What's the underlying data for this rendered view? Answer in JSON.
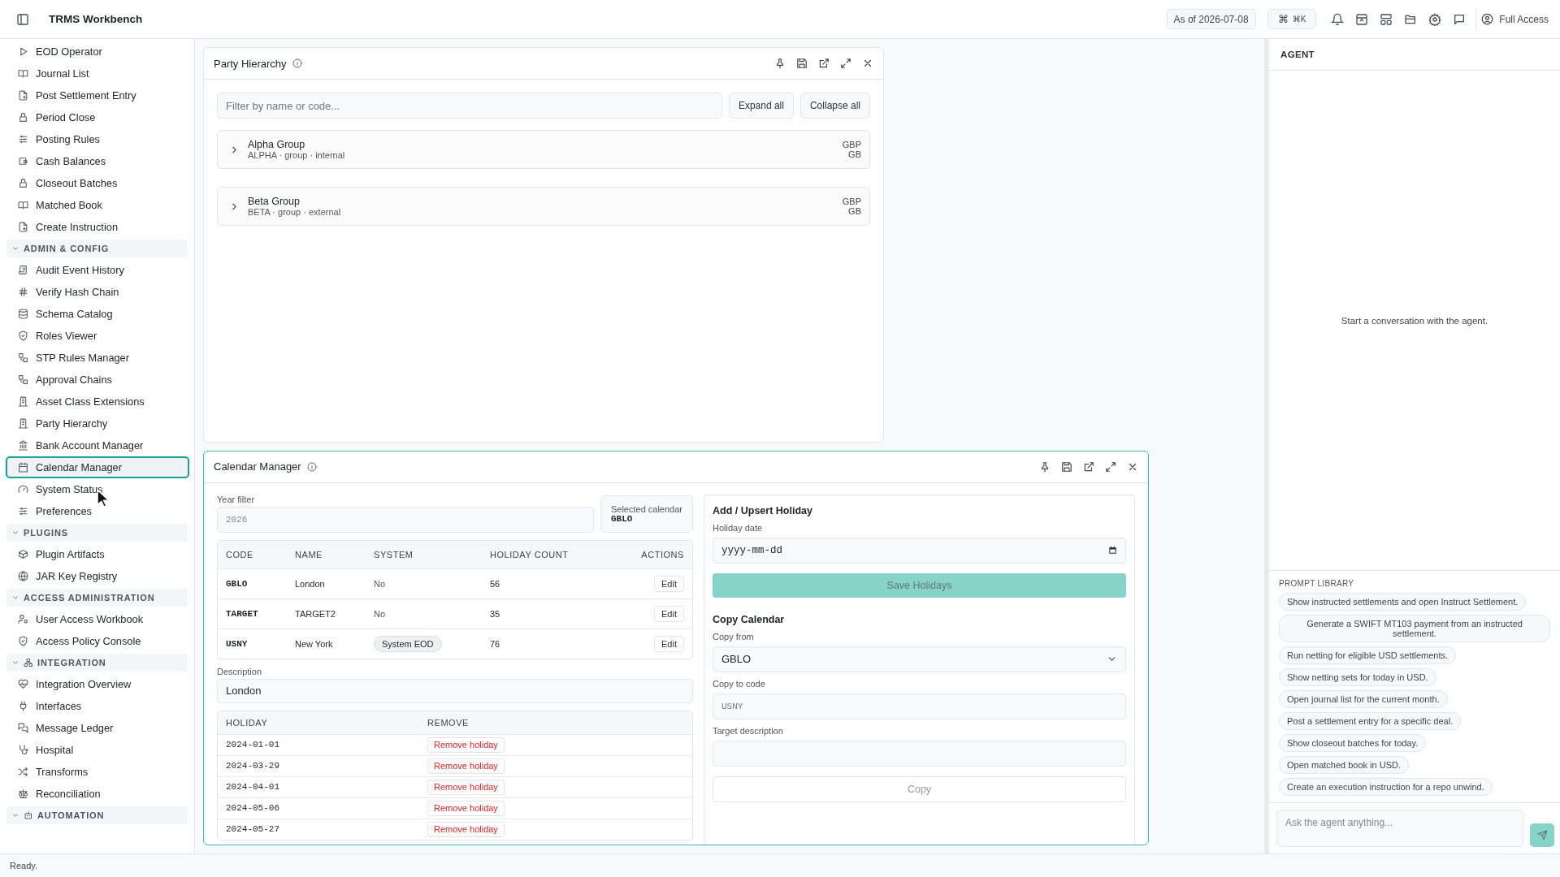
{
  "top_bar": {
    "title": "TRMS Workbench",
    "as_of": "As of 2026-07-08",
    "shortcut": {
      "symbol": "⌘",
      "keys": "⌘K"
    },
    "user": "Full Access"
  },
  "sidebar": {
    "items": [
      {
        "label": "EOD Operator",
        "selected": false
      },
      {
        "label": "Journal List",
        "selected": false
      },
      {
        "label": "Post Settlement Entry",
        "selected": false
      },
      {
        "label": "Period Close",
        "selected": false
      },
      {
        "label": "Posting Rules",
        "selected": false
      },
      {
        "label": "Cash Balances",
        "selected": false
      },
      {
        "label": "Closeout Batches",
        "selected": false
      },
      {
        "label": "Matched Book",
        "selected": false
      },
      {
        "label": "Create Instruction",
        "selected": false
      }
    ],
    "sections": [
      {
        "label": "ADMIN & CONFIG",
        "expanded": true,
        "items": [
          {
            "label": "Audit Event History",
            "selected": false
          },
          {
            "label": "Verify Hash Chain",
            "selected": false
          },
          {
            "label": "Schema Catalog",
            "selected": false
          },
          {
            "label": "Roles Viewer",
            "selected": false
          },
          {
            "label": "STP Rules Manager",
            "selected": false
          },
          {
            "label": "Approval Chains",
            "selected": false
          },
          {
            "label": "Asset Class Extensions",
            "selected": false
          },
          {
            "label": "Party Hierarchy",
            "selected": false
          },
          {
            "label": "Bank Account Manager",
            "selected": false
          },
          {
            "label": "Calendar Manager",
            "selected": true
          },
          {
            "label": "System Status",
            "selected": false
          },
          {
            "label": "Preferences",
            "selected": false
          }
        ]
      },
      {
        "label": "PLUGINS",
        "expanded": true,
        "items": [
          {
            "label": "Plugin Artifacts",
            "selected": false
          },
          {
            "label": "JAR Key Registry",
            "selected": false
          }
        ]
      },
      {
        "label": "ACCESS ADMINISTRATION",
        "expanded": true,
        "items": [
          {
            "label": "User Access Workbook",
            "selected": false
          },
          {
            "label": "Access Policy Console",
            "selected": false
          }
        ]
      },
      {
        "label": "INTEGRATION",
        "expanded": true,
        "items": [
          {
            "label": "Integration Overview",
            "selected": false
          },
          {
            "label": "Interfaces",
            "selected": false
          },
          {
            "label": "Message Ledger",
            "selected": false
          },
          {
            "label": "Hospital",
            "selected": false
          },
          {
            "label": "Transforms",
            "selected": false
          },
          {
            "label": "Reconciliation",
            "selected": false
          }
        ]
      },
      {
        "label": "AUTOMATION",
        "expanded": true
      }
    ]
  },
  "party_hierarchy": {
    "title": "Party Hierarchy",
    "focused": false,
    "filter_placeholder": "Filter by name or code...",
    "buttons": [
      "Expand all",
      "Collapse all"
    ],
    "groups": [
      {
        "name": "Alpha Group",
        "meta": "ALPHA · group · internal",
        "currency": "GBP",
        "country": "GB",
        "expanded": false
      },
      {
        "name": "Beta Group",
        "meta": "BETA · group · external",
        "currency": "GBP",
        "country": "GB",
        "expanded": false
      }
    ]
  },
  "calendar_manager": {
    "title": "Calendar Manager",
    "focused": true,
    "year_filter": {
      "label": "Year filter",
      "placeholder": "2026"
    },
    "selected_calendar": {
      "label": "Selected calendar",
      "value": "GBLO"
    },
    "calendars": {
      "columns": [
        "CODE",
        "NAME",
        "SYSTEM",
        "HOLIDAY COUNT",
        "ACTIONS"
      ],
      "rows": [
        {
          "code": "GBLO",
          "name": "London",
          "system": {
            "kind": "text",
            "text": "No"
          },
          "holiday_count": "56",
          "action": "Edit"
        },
        {
          "code": "TARGET",
          "name": "TARGET2",
          "system": {
            "kind": "text",
            "text": "No"
          },
          "holiday_count": "35",
          "action": "Edit"
        },
        {
          "code": "USNY",
          "name": "New York",
          "system": {
            "kind": "badge",
            "text": "System EOD"
          },
          "holiday_count": "76",
          "action": "Edit"
        }
      ]
    },
    "description": {
      "label": "Description",
      "value": "London"
    },
    "holidays": {
      "columns": [
        "HOLIDAY",
        "REMOVE"
      ],
      "rows": [
        {
          "date": "2024-01-01",
          "action": "Remove holiday"
        },
        {
          "date": "2024-03-29",
          "action": "Remove holiday"
        },
        {
          "date": "2024-04-01",
          "action": "Remove holiday"
        },
        {
          "date": "2024-05-06",
          "action": "Remove holiday"
        },
        {
          "date": "2024-05-27",
          "action": "Remove holiday"
        }
      ]
    },
    "add_holiday": {
      "title": "Add / Upsert Holiday",
      "date_label": "Holiday date",
      "date_placeholder": "yyyy-mm-dd",
      "save_button": {
        "label": "Save Holidays",
        "disabled": true
      }
    },
    "copy_calendar": {
      "title": "Copy Calendar",
      "copy_from_label": "Copy from",
      "copy_from_value": "GBLO",
      "copy_to_label": "Copy to code",
      "copy_to_placeholder": "USNY",
      "target_label": "Target description",
      "copy_button": {
        "label": "Copy",
        "disabled": true
      }
    }
  },
  "agent": {
    "title": "AGENT",
    "empty_message": "Start a conversation with the agent.",
    "prompt_library": {
      "title": "PROMPT LIBRARY",
      "prompts": [
        "Show instructed settlements and open Instruct Settlement.",
        "Generate a SWIFT MT103 payment from an instructed settlement.",
        "Run netting for eligible USD settlements.",
        "Show netting sets for today in USD.",
        "Open journal list for the current month.",
        "Post a settlement entry for a specific deal.",
        "Show closeout batches for today.",
        "Open matched book in USD.",
        "Create an execution instruction for a repo unwind."
      ]
    },
    "input_placeholder": "Ask the agent anything...",
    "send_disabled": true
  },
  "status_bar": {
    "text": "Ready."
  }
}
